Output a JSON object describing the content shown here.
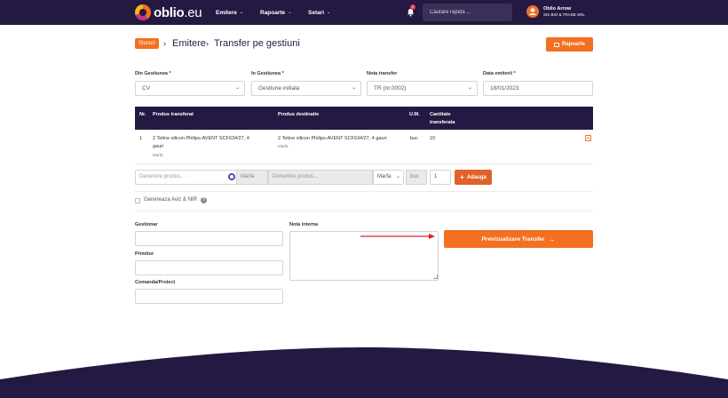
{
  "brand": {
    "logo_main": "oblio",
    "logo_suffix": ".eu"
  },
  "nav": [
    {
      "label": "Emitere"
    },
    {
      "label": "Rapoarte"
    },
    {
      "label": "Setari"
    }
  ],
  "notifications": {
    "count": "2"
  },
  "search": {
    "placeholder": "Cautare rapida ..."
  },
  "user": {
    "name": "Oblio Arrow",
    "company": "SIS BIO & TRADE SRL"
  },
  "breadcrumb": {
    "badge": "Stocuri",
    "level1": "Emitere",
    "level2": "Transfer pe gestiuni"
  },
  "toolbar": {
    "rapoarte_label": "Rapoarte"
  },
  "form": {
    "din_gestiunea": {
      "label": "Din Gestiunea *",
      "value": "CV"
    },
    "in_gestiunea": {
      "label": "In Gestiunea *",
      "value": "Gestiune initiala"
    },
    "nota_transfer": {
      "label": "Nota transfer",
      "value": "TR (nr.0002)"
    },
    "data_emiterii": {
      "label": "Data emiterii *",
      "value": "18/01/2023"
    }
  },
  "table": {
    "headers": {
      "nr": "Nr.",
      "produs_transferat": "Produs transferat",
      "produs_destinatie": "Produs destinatie",
      "um": "U.M.",
      "cantitate_line1": "Cantitate",
      "cantitate_line2": "transferata"
    },
    "rows": [
      {
        "nr": "1",
        "produs_transferat_line1": "2 Tetine silicon Philips-AVENT SCF634/27, 4",
        "produs_transferat_line2": "gauri",
        "produs_transferat_type": "Marfa",
        "produs_destinatie": "2 Tetine silicon Philips-AVENT SCF634/27, 4 gauri",
        "produs_destinatie_type": "Marfa",
        "um": "buc",
        "cantitate": "10"
      }
    ]
  },
  "add_row": {
    "product_placeholder": "Denumire produs...",
    "product_type": "Marfa",
    "dest_placeholder": "Denumire produs...",
    "dest_type": "Marfa",
    "um": "buc",
    "qty": "1",
    "add_label": "Adauga"
  },
  "options": {
    "genereaza_label": "Genereaza Aviz & NIR"
  },
  "bottom_form": {
    "gestionar_label": "Gestionar",
    "primitor_label": "Primitor",
    "comanda_label": "Comanda/Proiect",
    "nota_interna_label": "Nota interna",
    "preview_label": "Previzualizare Transfer"
  }
}
